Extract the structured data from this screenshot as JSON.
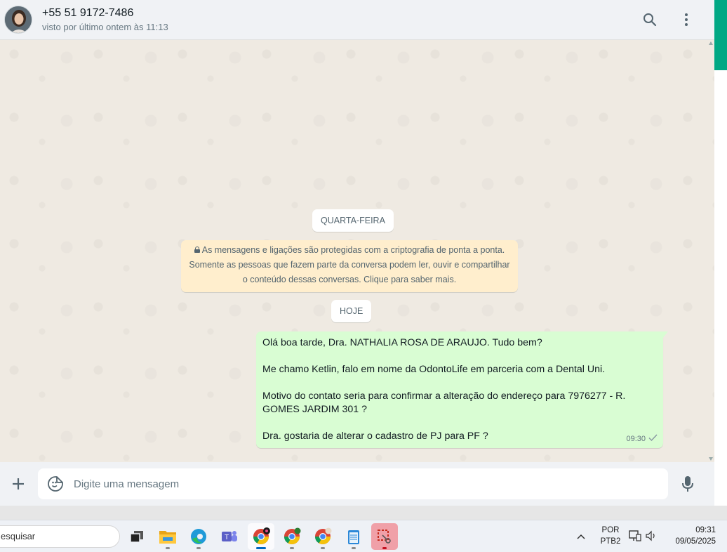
{
  "header": {
    "contact_name": "+55 51 9172-7486",
    "contact_status": "visto por último ontem às 11:13"
  },
  "chat": {
    "date_chip_1": "QUARTA-FEIRA",
    "encryption_line_1": "As mensagens e ligações são protegidas com a criptografia de ponta a ponta.",
    "encryption_line_2": "Somente as pessoas que fazem parte da conversa podem ler, ouvir e compartilhar",
    "encryption_line_3": "o conteúdo dessas conversas. Clique para saber mais.",
    "date_chip_2": "HOJE",
    "message": {
      "line_1": "Olá boa tarde, Dra. NATHALIA ROSA DE ARAUJO. Tudo bem?",
      "line_2": "Me chamo Ketlin, falo em nome da OdontoLife em parceria com a Dental Uni.",
      "line_3": "Motivo do contato seria para confirmar a alteração do endereço para 7976277 - R. GOMES JARDIM 301 ?",
      "line_4": "Dra. gostaria de alterar o cadastro de PJ para PF ?",
      "time": "09:30",
      "status_icon": "single-check-icon"
    }
  },
  "composer": {
    "placeholder": "Digite uma mensagem"
  },
  "taskbar": {
    "search_text": "esquisar",
    "apps": [
      "task-view-icon",
      "file-explorer-icon",
      "edge-icon",
      "teams-icon",
      "chrome-icon",
      "chrome-icon",
      "chrome-icon",
      "notepad-icon",
      "snipping-tool-icon"
    ],
    "lang_1": "POR",
    "lang_2": "PTB2",
    "time": "09:31",
    "date": "09/05/2025"
  },
  "colors": {
    "accent": "#00a884",
    "outgoing_bubble": "#d9fdd3",
    "encryption_banner": "#ffeecd"
  }
}
